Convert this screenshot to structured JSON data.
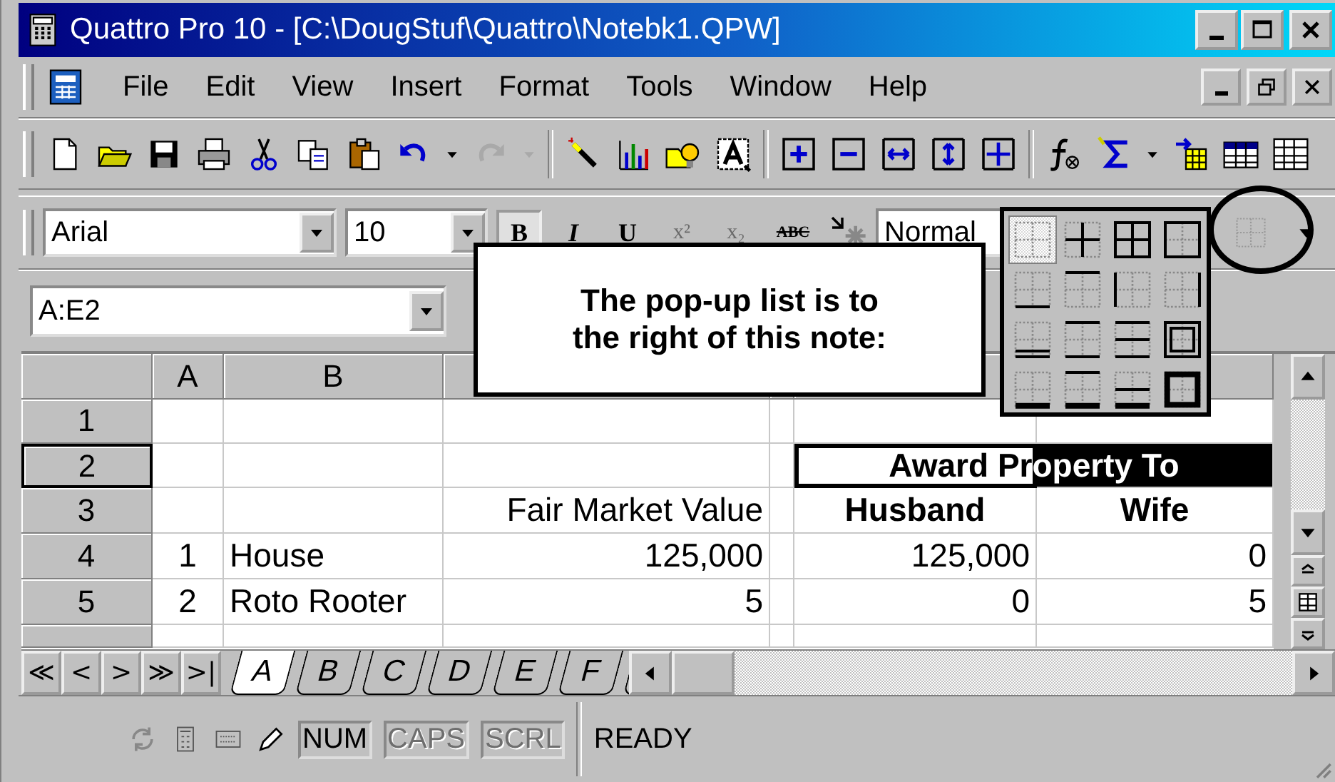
{
  "window": {
    "title": "Quattro Pro 10 - [C:\\DougStuf\\Quattro\\Notebk1.QPW]"
  },
  "menu": [
    "File",
    "Edit",
    "View",
    "Insert",
    "Format",
    "Tools",
    "Window",
    "Help"
  ],
  "toolbar": [
    {
      "disabled": false
    },
    {
      "disabled": false
    },
    {
      "disabled": false
    },
    {
      "disabled": false
    },
    {
      "disabled": false
    },
    {
      "disabled": false
    },
    {
      "disabled": false
    },
    {
      "disabled": false
    },
    {
      "disabled": false
    },
    {
      "disabled": true
    },
    {
      "disabled": true
    },
    {
      "disabled": false
    },
    {
      "disabled": false
    },
    {
      "disabled": false
    },
    {
      "disabled": false
    },
    {
      "disabled": false
    },
    {
      "disabled": false
    },
    {
      "disabled": false
    },
    {
      "disabled": false
    },
    {
      "disabled": false
    },
    {
      "disabled": false
    },
    {
      "disabled": false
    },
    {
      "disabled": false
    },
    {
      "disabled": false
    },
    {
      "disabled": false
    },
    {
      "disabled": false
    }
  ],
  "format_bar": {
    "font": "Arial",
    "size": "10",
    "style": "Normal",
    "buttons": [
      {
        "kind": "bold",
        "label": "B",
        "pressed": true,
        "disabled": false
      },
      {
        "kind": "italic",
        "label": "I",
        "pressed": false,
        "disabled": false
      },
      {
        "kind": "underline",
        "label": "U",
        "pressed": false,
        "disabled": false
      },
      {
        "kind": "superscript",
        "label": "x²",
        "pressed": false,
        "disabled": true
      },
      {
        "kind": "subscript",
        "label": "x₂",
        "pressed": false,
        "disabled": true
      },
      {
        "kind": "strikeout",
        "label": "ABC",
        "pressed": false,
        "disabled": false
      }
    ]
  },
  "name_box": "A:E2",
  "note": "The pop-up list is to\nthe right of this note:",
  "border_palette": [
    {
      "selected": true
    },
    {
      "selected": false
    },
    {
      "selected": false
    },
    {
      "selected": false
    },
    {
      "selected": false
    },
    {
      "selected": false
    },
    {
      "selected": false
    },
    {
      "selected": false
    },
    {
      "selected": false
    },
    {
      "selected": false
    },
    {
      "selected": false
    },
    {
      "selected": false
    },
    {
      "selected": false
    },
    {
      "selected": false
    },
    {
      "selected": false
    },
    {
      "selected": false
    }
  ],
  "sheet": {
    "columns": [
      {
        "label": "A"
      },
      {
        "label": "B"
      },
      {},
      {},
      {},
      {}
    ],
    "rows": [
      {
        "label": "1",
        "active": false,
        "cells": [
          {
            "selected": false,
            "active": false
          },
          {
            "selected": false,
            "active": false
          },
          {
            "selected": false,
            "active": false
          },
          {
            "selected": false,
            "active": false
          },
          {
            "selected": false,
            "active": false
          },
          {
            "selected": false,
            "active": false
          }
        ]
      },
      {
        "label": "2",
        "active": true,
        "cells": [
          {
            "selected": false,
            "active": false
          },
          {
            "selected": false,
            "active": false
          },
          {
            "selected": false,
            "active": false
          },
          {
            "selected": false,
            "active": false
          },
          {
            "text": "Award Property To",
            "kind": "title",
            "selected": true,
            "active": true
          },
          {
            "selected": true,
            "active": false
          }
        ]
      },
      {
        "label": "3",
        "active": false,
        "cells": [
          {
            "selected": false,
            "active": false
          },
          {
            "selected": false,
            "active": false
          },
          {
            "text": "Fair Market Value",
            "kind": "number",
            "selected": false,
            "active": false
          },
          {
            "selected": false,
            "active": false
          },
          {
            "text": "Husband",
            "kind": "heading",
            "selected": false,
            "active": false
          },
          {
            "text": "Wife",
            "kind": "heading",
            "selected": false,
            "active": false
          }
        ]
      },
      {
        "label": "4",
        "active": false,
        "cells": [
          {
            "text": "1",
            "kind": "index",
            "selected": false,
            "active": false
          },
          {
            "text": "House",
            "kind": "text",
            "selected": false,
            "active": false
          },
          {
            "text": "125,000",
            "kind": "number",
            "selected": false,
            "active": false
          },
          {
            "selected": false,
            "active": false
          },
          {
            "text": "125,000",
            "kind": "number",
            "selected": false,
            "active": false
          },
          {
            "text": "0",
            "kind": "number",
            "selected": false,
            "active": false
          }
        ]
      },
      {
        "label": "5",
        "active": false,
        "cells": [
          {
            "text": "2",
            "kind": "index",
            "selected": false,
            "active": false
          },
          {
            "text": "Roto Rooter",
            "kind": "text",
            "selected": false,
            "active": false
          },
          {
            "text": "5",
            "kind": "number",
            "selected": false,
            "active": false
          },
          {
            "selected": false,
            "active": false
          },
          {
            "text": "0",
            "kind": "number",
            "selected": false,
            "active": false
          },
          {
            "text": "5",
            "kind": "number",
            "selected": false,
            "active": false
          }
        ]
      },
      {
        "active": false,
        "cells": [
          {
            "selected": false,
            "active": false
          },
          {
            "selected": false,
            "active": false
          },
          {
            "selected": false,
            "active": false
          },
          {
            "selected": false,
            "active": false
          },
          {
            "selected": false,
            "active": false
          },
          {
            "selected": false,
            "active": false
          }
        ]
      }
    ]
  },
  "sheet_nav": [
    "≪",
    "<",
    ">",
    "≫",
    ">|"
  ],
  "sheet_tabs": [
    {
      "label": "A",
      "selected": true
    },
    {
      "label": "B",
      "selected": false
    },
    {
      "label": "C",
      "selected": false
    },
    {
      "label": "D",
      "selected": false
    },
    {
      "label": "E",
      "selected": false
    },
    {
      "label": "F",
      "selected": false
    },
    {
      "selected": false
    }
  ],
  "status_bar": {
    "indicators": [
      {
        "label": "NUM",
        "on": true
      },
      {
        "label": "CAPS",
        "on": false
      },
      {
        "label": "SCRL",
        "on": false
      }
    ],
    "mode": "READY"
  }
}
